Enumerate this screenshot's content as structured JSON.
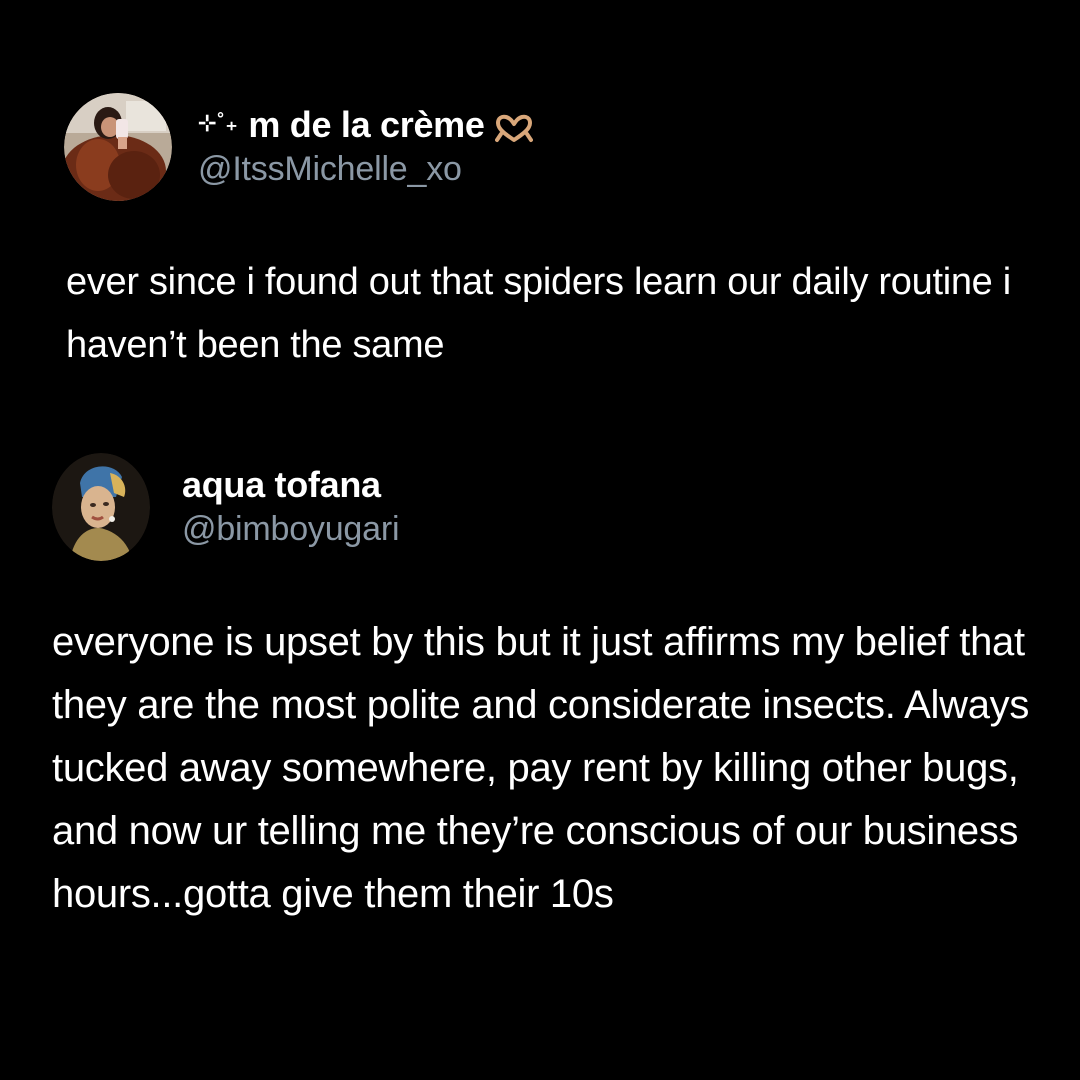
{
  "tweets": [
    {
      "sparkles": "⊹˚₊",
      "display_name": "m de la crème",
      "name_icon": "heart-hands-icon",
      "handle": "@ItssMichelle_xo",
      "avatar": "profile-photo-avatar",
      "text": "ever since i found out that spiders learn our daily routine i haven’t been the same"
    },
    {
      "display_name": "aqua tofana",
      "handle": "@bimboyugari",
      "avatar": "girl-with-pearl-earring-avatar",
      "text": "everyone is upset by this but it just affirms my belief that they are the most polite and considerate insects. Always tucked away somewhere, pay rent by killing other bugs, and now ur telling me they’re conscious of our business hours...gotta give them their 10s"
    }
  ],
  "colors": {
    "background": "#000000",
    "text": "#ffffff",
    "handle": "#8b98a5",
    "heart_icon": "#d9a77a"
  }
}
